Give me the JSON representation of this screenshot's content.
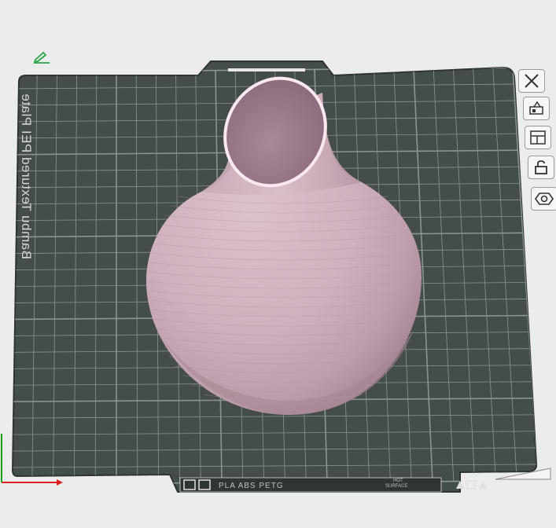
{
  "plate": {
    "name": "Bambu Textured PEI Plate",
    "material_label": "PLA ABS PETG",
    "hot_surface_line1": "HOT",
    "hot_surface_line2": "SURFACE"
  },
  "side_toolbar": [
    {
      "id": "close",
      "icon": "close-icon"
    },
    {
      "id": "arrange",
      "icon": "arrange-icon"
    },
    {
      "id": "layout",
      "icon": "layout-icon"
    },
    {
      "id": "lock",
      "icon": "lock-icon"
    },
    {
      "id": "settings",
      "icon": "gear-icon"
    }
  ],
  "colors": {
    "plate": "#444c4c",
    "grid": "#8b9393",
    "model": "#d8b9c6",
    "model_shadow": "#a58592",
    "model_rim": "#fde7f0",
    "axis_x": "#e02020",
    "axis_y": "#1aa01a",
    "edit_icon": "#29a64a"
  }
}
